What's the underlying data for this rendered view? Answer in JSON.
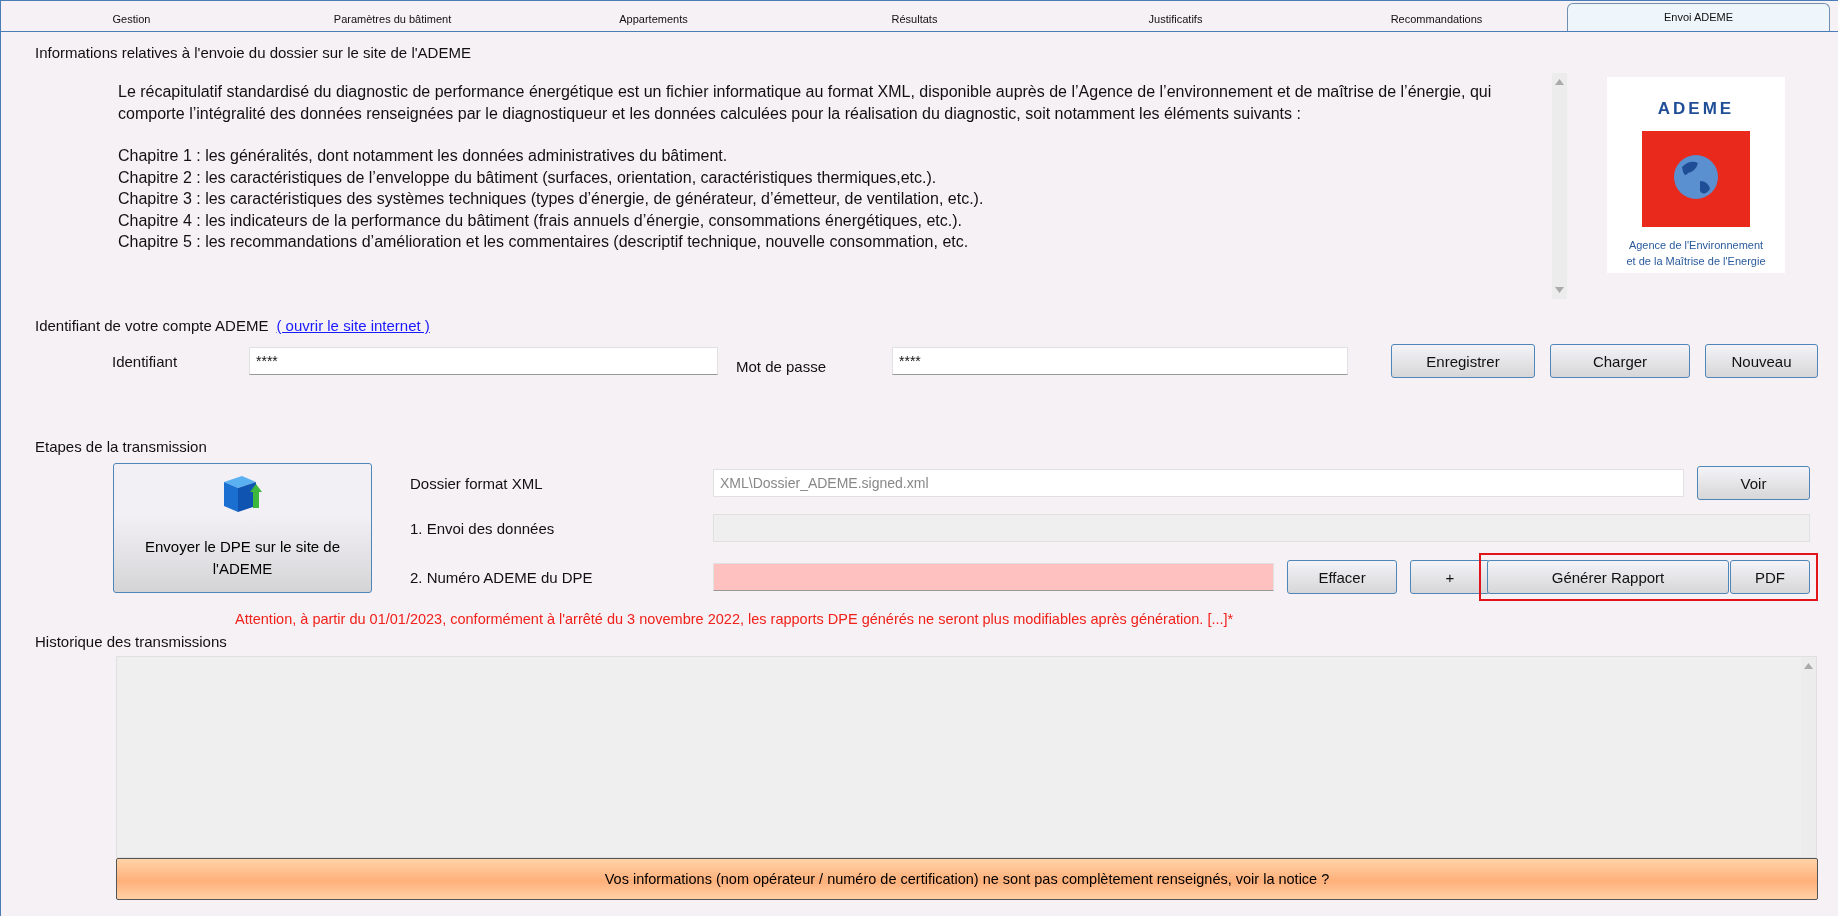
{
  "tabs": [
    {
      "label": "Gestion",
      "selected": false
    },
    {
      "label": "Paramètres du bâtiment",
      "selected": false
    },
    {
      "label": "Appartements",
      "selected": false
    },
    {
      "label": "Résultats",
      "selected": false
    },
    {
      "label": "Justificatifs",
      "selected": false
    },
    {
      "label": "Recommandations",
      "selected": false
    },
    {
      "label": "Envoi ADEME",
      "selected": true
    }
  ],
  "section_title": "Informations relatives à l'envoie du dossier sur le site de l'ADEME",
  "description": {
    "intro": "Le récapitulatif standardisé du diagnostic de performance énergétique est un fichier informatique au format XML, disponible auprès de l’Agence de l’environnement et de maîtrise de l’énergie, qui comporte l’intégralité des données renseignées par le diagnostiqueur et les données calculées pour la réalisation du diagnostic, soit notamment les éléments suivants :",
    "chapters": [
      "Chapitre 1 : les généralités, dont notamment les données administratives du bâtiment.",
      "Chapitre 2 : les caractéristiques de l’enveloppe du bâtiment (surfaces, orientation, caractéristiques thermiques,etc.).",
      "Chapitre 3 : les caractéristiques des systèmes techniques (types d’énergie, de générateur, d’émetteur, de ventilation, etc.).",
      "Chapitre 4 : les indicateurs de la performance du bâtiment (frais annuels d’énergie, consommations énergétiques, etc.).",
      "Chapitre 5 : les recommandations d’amélioration et les commentaires (descriptif technique, nouvelle consommation,  etc."
    ]
  },
  "logo": {
    "name": "ADEME",
    "subtitle_1": "Agence de l'Environnement",
    "subtitle_2": "et de la Maîtrise de l'Energie"
  },
  "account": {
    "title": "Identifiant de votre compte ADEME",
    "link": "( ouvrir le site internet )",
    "login_label": "Identifiant",
    "login_value": "****",
    "password_label": "Mot de passe",
    "password_value": "****",
    "buttons": [
      "Enregistrer",
      "Charger",
      "Nouveau"
    ]
  },
  "transmission": {
    "title": "Etapes de la transmission",
    "send_button": "Envoyer le DPE sur le site de l'ADEME",
    "xml_label": "Dossier format XML",
    "xml_value": "XML\\Dossier_ADEME.signed.xml",
    "view_button": "Voir",
    "send_label": "1. Envoi des données",
    "send_disabled": true,
    "number_label": "2. Numéro ADEME du DPE",
    "number_invalid": true,
    "clear_button": "Effacer",
    "plus_button": "+",
    "report_button": "Générer Rapport",
    "pdf_button": "PDF",
    "report_highlighted": true
  },
  "warning": "Attention, à partir du 01/01/2023, conformément à l'arrêté du 3 novembre 2022, les rapports DPE générés ne seront plus modifiables après génération. [...]*",
  "history": {
    "title": "Historique des transmissions"
  },
  "notice": "Vos informations (nom opérateur / numéro de certification) ne sont pas complètement renseignés, voir la notice ?"
}
